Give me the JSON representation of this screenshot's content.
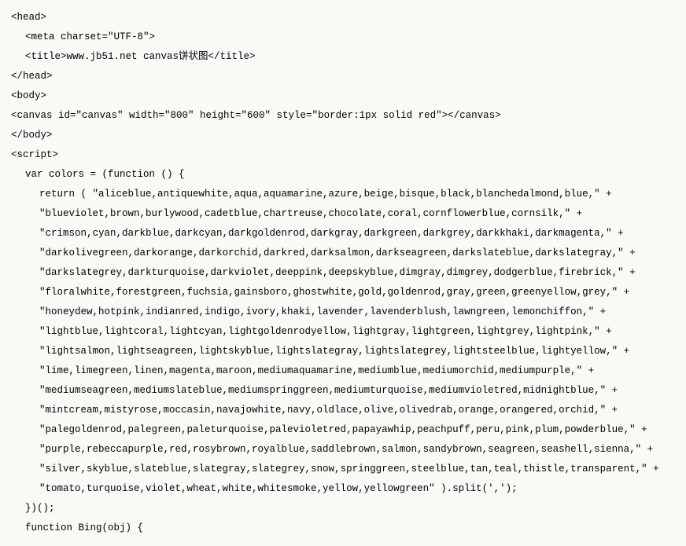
{
  "lines": [
    {
      "cls": "",
      "text": "<head>"
    },
    {
      "cls": "ind1",
      "text": "<meta charset=\"UTF-8\">"
    },
    {
      "cls": "ind1",
      "text": "<title>www.jb51.net canvas饼状图</title>"
    },
    {
      "cls": "",
      "text": "</head>"
    },
    {
      "cls": "",
      "text": "<body>"
    },
    {
      "cls": "",
      "text": "<canvas id=\"canvas\" width=\"800\" height=\"600\" style=\"border:1px solid red\"></canvas>"
    },
    {
      "cls": "",
      "text": "</body>"
    },
    {
      "cls": "",
      "text": "<script>"
    },
    {
      "cls": "ind1",
      "text": "var colors = (function () {"
    },
    {
      "cls": "ind2",
      "text": "return ( \"aliceblue,antiquewhite,aqua,aquamarine,azure,beige,bisque,black,blanchedalmond,blue,\" +"
    },
    {
      "cls": "ind2",
      "text": "\"blueviolet,brown,burlywood,cadetblue,chartreuse,chocolate,coral,cornflowerblue,cornsilk,\" +"
    },
    {
      "cls": "ind2",
      "text": "\"crimson,cyan,darkblue,darkcyan,darkgoldenrod,darkgray,darkgreen,darkgrey,darkkhaki,darkmagenta,\" +"
    },
    {
      "cls": "ind2",
      "text": "\"darkolivegreen,darkorange,darkorchid,darkred,darksalmon,darkseagreen,darkslateblue,darkslategray,\" +"
    },
    {
      "cls": "ind2",
      "text": "\"darkslategrey,darkturquoise,darkviolet,deeppink,deepskyblue,dimgray,dimgrey,dodgerblue,firebrick,\" +"
    },
    {
      "cls": "ind2",
      "text": "\"floralwhite,forestgreen,fuchsia,gainsboro,ghostwhite,gold,goldenrod,gray,green,greenyellow,grey,\" +"
    },
    {
      "cls": "ind2",
      "text": "\"honeydew,hotpink,indianred,indigo,ivory,khaki,lavender,lavenderblush,lawngreen,lemonchiffon,\" +"
    },
    {
      "cls": "ind2",
      "text": "\"lightblue,lightcoral,lightcyan,lightgoldenrodyellow,lightgray,lightgreen,lightgrey,lightpink,\" +"
    },
    {
      "cls": "ind2",
      "text": "\"lightsalmon,lightseagreen,lightskyblue,lightslategray,lightslategrey,lightsteelblue,lightyellow,\" +"
    },
    {
      "cls": "ind2",
      "text": "\"lime,limegreen,linen,magenta,maroon,mediumaquamarine,mediumblue,mediumorchid,mediumpurple,\" +"
    },
    {
      "cls": "ind2",
      "text": "\"mediumseagreen,mediumslateblue,mediumspringgreen,mediumturquoise,mediumvioletred,midnightblue,\" +"
    },
    {
      "cls": "ind2",
      "text": "\"mintcream,mistyrose,moccasin,navajowhite,navy,oldlace,olive,olivedrab,orange,orangered,orchid,\" +"
    },
    {
      "cls": "ind2",
      "text": "\"palegoldenrod,palegreen,paleturquoise,palevioletred,papayawhip,peachpuff,peru,pink,plum,powderblue,\" +"
    },
    {
      "cls": "ind2",
      "text": "\"purple,rebeccapurple,red,rosybrown,royalblue,saddlebrown,salmon,sandybrown,seagreen,seashell,sienna,\" +"
    },
    {
      "cls": "ind2",
      "text": "\"silver,skyblue,slateblue,slategray,slategrey,snow,springgreen,steelblue,tan,teal,thistle,transparent,\" +"
    },
    {
      "cls": "ind2",
      "text": "\"tomato,turquoise,violet,wheat,white,whitesmoke,yellow,yellowgreen\" ).split(',');"
    },
    {
      "cls": "ind1",
      "text": "})();"
    },
    {
      "cls": "ind1",
      "text": "function Bing(obj) {"
    }
  ]
}
